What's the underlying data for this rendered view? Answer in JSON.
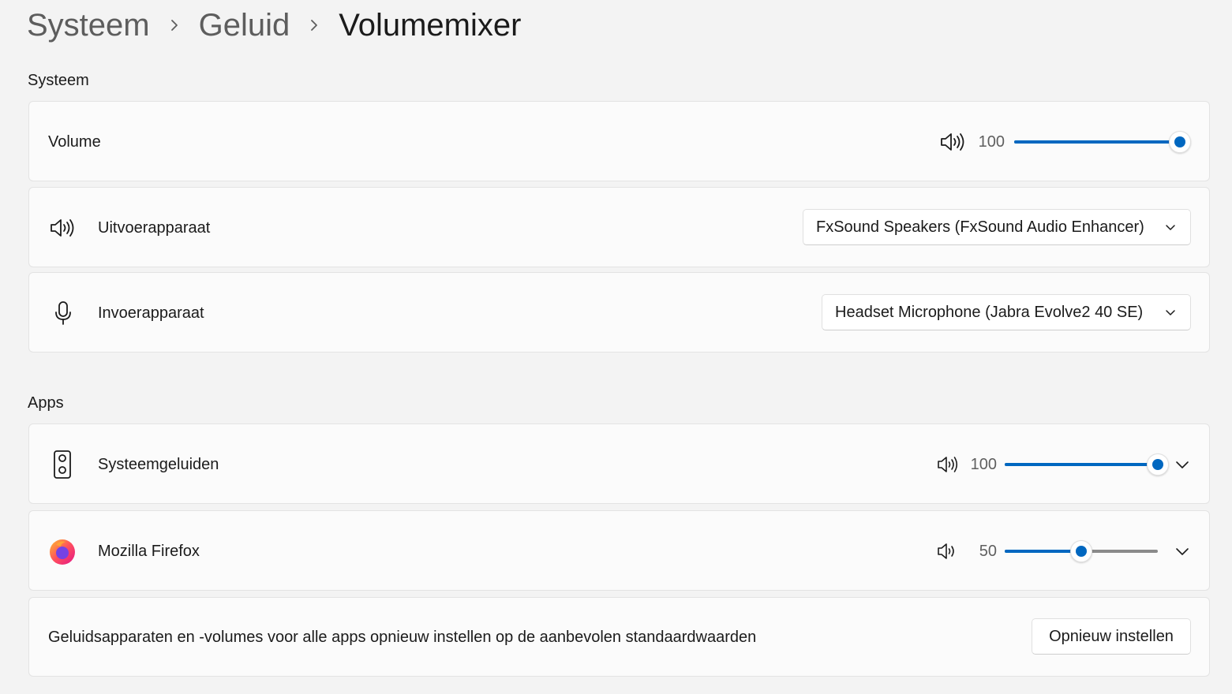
{
  "breadcrumb": {
    "items": [
      "Systeem",
      "Geluid",
      "Volumemixer"
    ]
  },
  "system_section": {
    "title": "Systeem",
    "volume": {
      "label": "Volume",
      "value": "100",
      "level": 1.0,
      "icon": "speaker-high-icon"
    },
    "output": {
      "label": "Uitvoerapparaat",
      "selected": "FxSound Speakers (FxSound Audio Enhancer)",
      "icon": "speaker-high-icon"
    },
    "input": {
      "label": "Invoerapparaat",
      "selected": "Headset Microphone (Jabra Evolve2 40 SE)",
      "icon": "microphone-icon"
    }
  },
  "apps_section": {
    "title": "Apps",
    "apps": [
      {
        "name": "Systeemgeluiden",
        "value": "100",
        "level": 1.0,
        "icon": "system-speaker-icon"
      },
      {
        "name": "Mozilla Firefox",
        "value": "50",
        "level": 0.5,
        "icon": "firefox-icon"
      }
    ]
  },
  "reset": {
    "description": "Geluidsapparaten en -volumes voor alle apps opnieuw instellen op de aanbevolen standaardwaarden",
    "button_label": "Opnieuw instellen"
  },
  "colors": {
    "accent": "#0067c0",
    "background": "#f3f3f3",
    "card": "#fbfbfb"
  }
}
